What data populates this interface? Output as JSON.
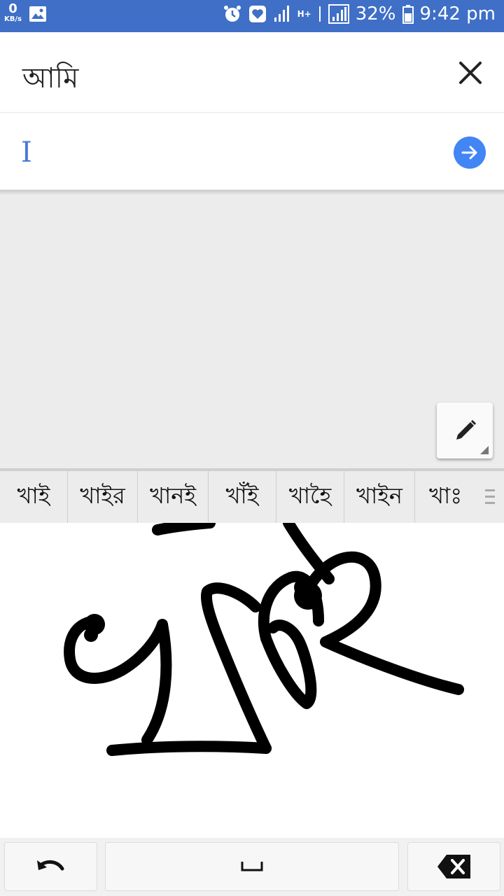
{
  "status_bar": {
    "network_speed_value": "0",
    "network_speed_unit": "KB/s",
    "network_type": "H+",
    "battery_percent": "32%",
    "time": "9:42 pm",
    "icons": [
      "image-icon",
      "alarm-icon",
      "heart-shield-icon",
      "signal-icon",
      "data-arrows-icon",
      "signal-icon",
      "battery-icon"
    ]
  },
  "header": {
    "title": "আমি",
    "close_icon": "close-icon"
  },
  "input": {
    "value": "I",
    "submit_icon": "arrow-right-icon"
  },
  "pen_tool": {
    "icon": "pen-icon"
  },
  "suggestions": [
    "খাই",
    "খাইর",
    "খানই",
    "খাঁই",
    "খাহৈ",
    "খাইন",
    "খাঃ"
  ],
  "suggestions_more_icon": "more-icon",
  "keyboard": {
    "undo_icon": "undo-icon",
    "space_icon": "space-icon",
    "backspace_icon": "backspace-icon"
  },
  "colors": {
    "status_bar": "#3f6fc6",
    "accent": "#4285f4",
    "canvas_bg": "#ececec"
  }
}
